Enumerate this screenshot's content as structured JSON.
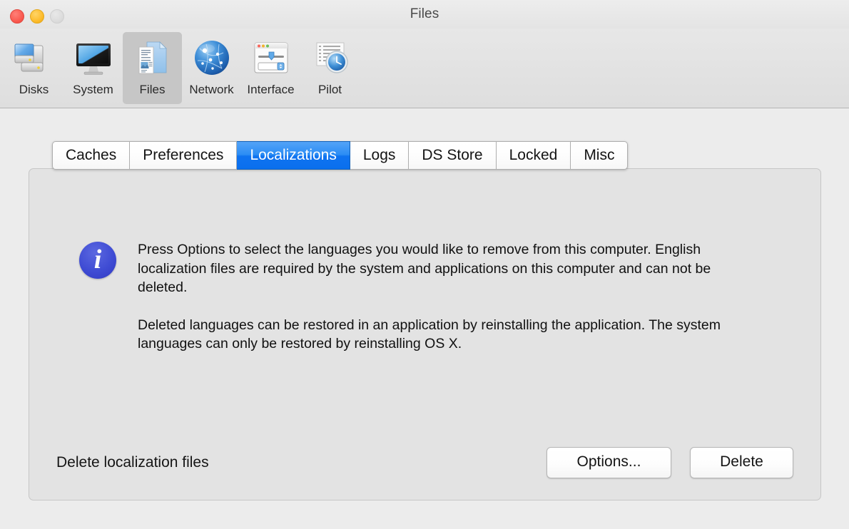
{
  "window": {
    "title": "Files",
    "traffic_lights": [
      {
        "name": "close",
        "color": "#fa5a50"
      },
      {
        "name": "minimize",
        "color": "#fdbc2c"
      },
      {
        "name": "zoom",
        "color": "#dcdcdc"
      }
    ]
  },
  "toolbar": {
    "items": [
      {
        "id": "disks",
        "label": "Disks",
        "icon": "disks-icon",
        "selected": false
      },
      {
        "id": "system",
        "label": "System",
        "icon": "display-icon",
        "selected": false
      },
      {
        "id": "files",
        "label": "Files",
        "icon": "documents-icon",
        "selected": true
      },
      {
        "id": "network",
        "label": "Network",
        "icon": "globe-icon",
        "selected": false
      },
      {
        "id": "interface",
        "label": "Interface",
        "icon": "window-controls-icon",
        "selected": false
      },
      {
        "id": "pilot",
        "label": "Pilot",
        "icon": "clock-list-icon",
        "selected": false
      }
    ]
  },
  "tabs": [
    {
      "id": "caches",
      "label": "Caches",
      "active": false
    },
    {
      "id": "preferences",
      "label": "Preferences",
      "active": false
    },
    {
      "id": "localizations",
      "label": "Localizations",
      "active": true
    },
    {
      "id": "logs",
      "label": "Logs",
      "active": false
    },
    {
      "id": "ds-store",
      "label": "DS Store",
      "active": false
    },
    {
      "id": "locked",
      "label": "Locked",
      "active": false
    },
    {
      "id": "misc",
      "label": "Misc",
      "active": false
    }
  ],
  "panel": {
    "info": {
      "icon": "info-icon",
      "paragraph_1": "Press Options to select the languages you would like to remove from this computer. English localization files are required by the system and applications on this computer and can not be deleted.",
      "paragraph_2": "Deleted languages can be restored in an application by reinstalling the application. The system languages can only be restored by reinstalling OS X."
    },
    "footer": {
      "label": "Delete localization files",
      "options_button": "Options...",
      "delete_button": "Delete"
    }
  },
  "colors": {
    "accent_blue": "#0f73f0",
    "info_blue": "#3f4cd4",
    "window_bg": "#ececec",
    "panel_bg": "#e3e3e3",
    "toolbar_selection": "#c6c6c6"
  }
}
